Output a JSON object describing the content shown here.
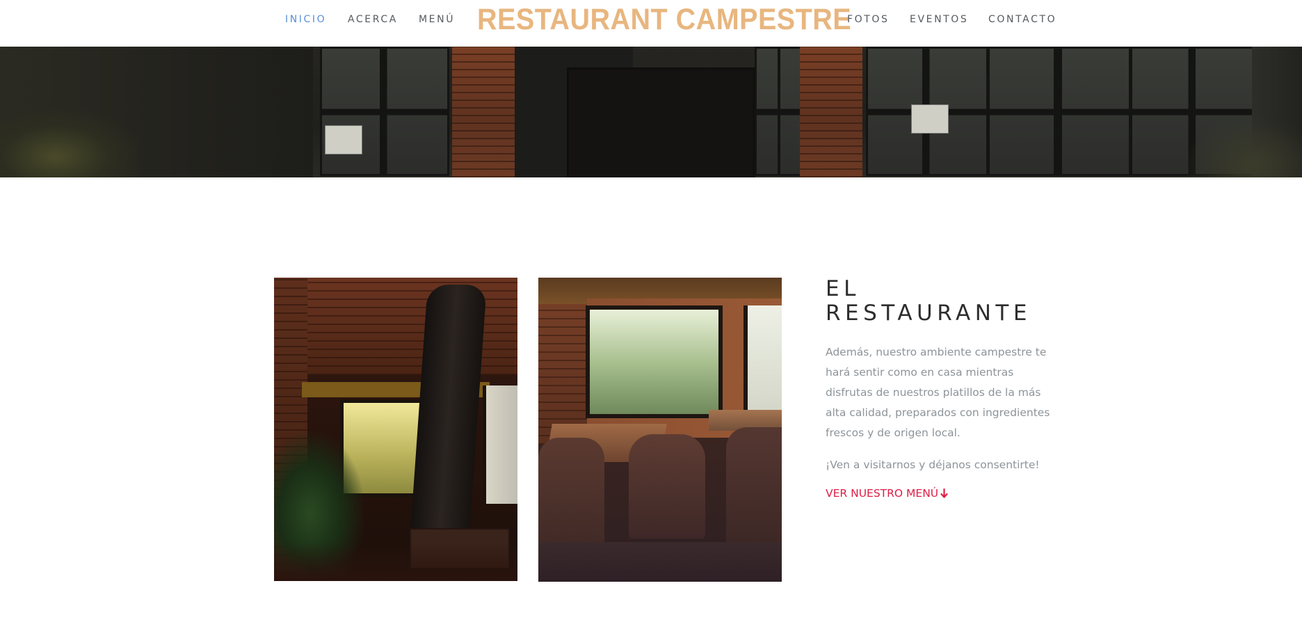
{
  "nav": {
    "items": [
      {
        "label": "INICIO",
        "active": true
      },
      {
        "label": "ACERCA",
        "active": false
      },
      {
        "label": "MENÚ",
        "active": false
      },
      {
        "label": "FOTOS",
        "active": false
      },
      {
        "label": "EVENTOS",
        "active": false
      },
      {
        "label": "CONTACTO",
        "active": false
      }
    ],
    "brand": "RESTAURANT CAMPESTRE",
    "active_color": "#5b8fd8",
    "brand_color": "#e8b67f"
  },
  "hero": {
    "image": "restaurant-facade-photo"
  },
  "gallery": {
    "images": [
      "interior-tree-dining-photo",
      "dining-tables-window-photo"
    ]
  },
  "about": {
    "title_line1": "EL",
    "title_line2": "RESTAURANTE",
    "paragraph1": "Además, nuestro ambiente campestre te hará sentir como en casa mientras disfrutas de nuestros platillos de la más alta calidad, preparados con ingredientes frescos y de origen local.",
    "paragraph2": "¡Ven a visitarnos y déjanos consentirte!",
    "menu_link": "VER NUESTRO MENÚ",
    "link_icon": "arrow-down-icon",
    "link_color": "#dc1e46"
  }
}
